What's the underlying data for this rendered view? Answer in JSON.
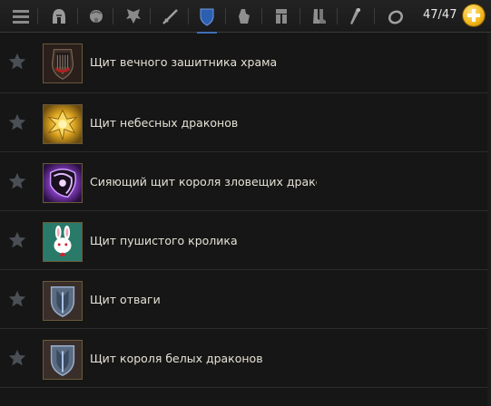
{
  "toolbar": {
    "icons": [
      {
        "name": "menu-icon"
      },
      {
        "name": "helmet-icon"
      },
      {
        "name": "pauldrons-icon"
      },
      {
        "name": "wings-icon"
      },
      {
        "name": "swords-icon"
      },
      {
        "name": "shield-icon"
      },
      {
        "name": "gauntlet-icon"
      },
      {
        "name": "greaves-icon"
      },
      {
        "name": "boots-icon"
      },
      {
        "name": "staff-icon"
      },
      {
        "name": "ring-icon"
      }
    ],
    "counter": "47/47",
    "active_color": "#3f6fb8"
  },
  "items": [
    {
      "name": "Щит вечного зашитника храма",
      "icon": "temple-shield-icon"
    },
    {
      "name": "Щит небесных драконов",
      "icon": "celestial-dragon-shield-icon"
    },
    {
      "name": "Сияющий щит короля зловещих дракон...",
      "icon": "radiant-dragon-king-shield-icon"
    },
    {
      "name": "Щит пушистого кролика",
      "icon": "fluffy-rabbit-shield-icon"
    },
    {
      "name": "Щит отваги",
      "icon": "valor-shield-icon"
    },
    {
      "name": "Щит короля белых драконов",
      "icon": "white-dragon-king-shield-icon"
    }
  ]
}
